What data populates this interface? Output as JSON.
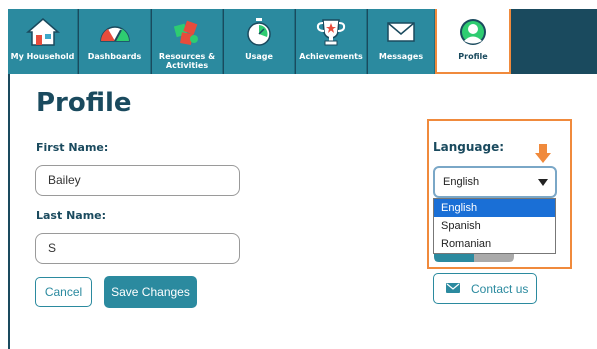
{
  "nav": {
    "tabs": [
      {
        "label": "My Household",
        "icon": "house-icon"
      },
      {
        "label": "Dashboards",
        "icon": "gauge-icon"
      },
      {
        "label": "Resources & Activities",
        "icon": "puzzle-icon"
      },
      {
        "label": "Usage",
        "icon": "stopwatch-icon"
      },
      {
        "label": "Achievements",
        "icon": "trophy-icon"
      },
      {
        "label": "Messages",
        "icon": "envelope-icon"
      },
      {
        "label": "Profile",
        "icon": "user-avatar-icon",
        "active": true
      }
    ]
  },
  "page": {
    "title": "Profile"
  },
  "form": {
    "first_name_label": "First Name:",
    "first_name_value": "Bailey",
    "last_name_label": "Last Name:",
    "last_name_value": "S",
    "cancel_label": "Cancel",
    "save_label": "Save Changes"
  },
  "language": {
    "label": "Language:",
    "selected": "English",
    "options": [
      "English",
      "Spanish",
      "Romanian"
    ]
  },
  "contact": {
    "label": "Contact us"
  },
  "colors": {
    "nav_bg": "#1a4a5e",
    "tab_bg": "#2b8a9f",
    "highlight_orange": "#f08a3c",
    "selected_option": "#1a6fd6"
  }
}
